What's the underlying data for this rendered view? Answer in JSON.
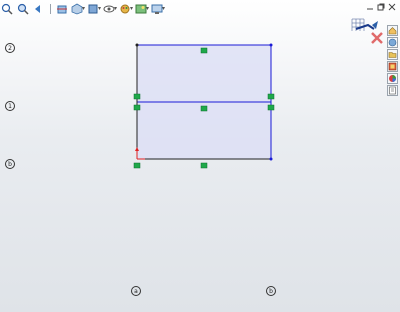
{
  "toolbar": {
    "items": [
      "zoom-to-fit",
      "zoom-to-area",
      "previous-view",
      "section-view",
      "view-orientation",
      "display-style",
      "hide-show-items",
      "edit-appearance",
      "apply-scene",
      "view-settings"
    ]
  },
  "grid_labels": {
    "left_top": "2",
    "left_middle": "1",
    "left_bottom": "b",
    "bottom_left": "a",
    "bottom_right": "b"
  },
  "colors": {
    "sketch_line": "#1a1ad6",
    "sketch_fixed_line": "#222222",
    "handle": "#1fa84a",
    "fill": "#dcdff5",
    "origin": "#e02020"
  }
}
